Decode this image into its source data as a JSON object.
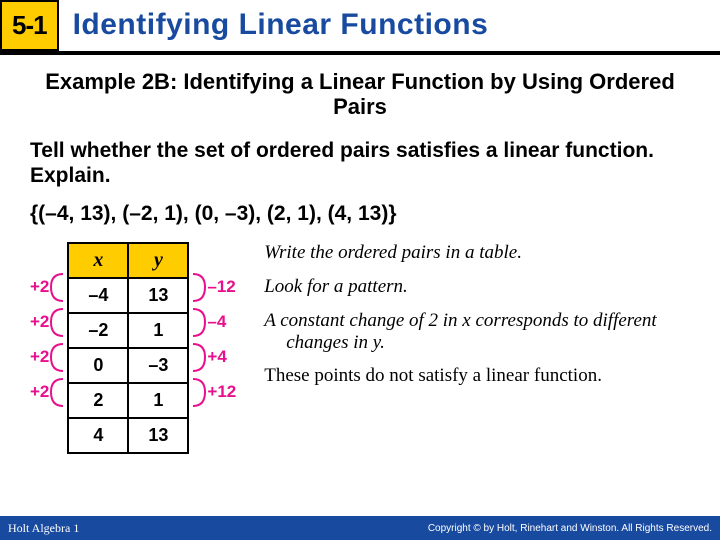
{
  "header": {
    "badge": "5-1",
    "title": "Identifying Linear Functions"
  },
  "example_title": "Example 2B: Identifying a Linear Function by Using Ordered Pairs",
  "instruction": "Tell whether the set of ordered pairs satisfies a linear function. Explain.",
  "ordered_pairs": "{(–4, 13), (–2, 1), (0, –3), (2, 1), (4, 13)}",
  "table": {
    "head_x": "x",
    "head_y": "y",
    "rows": [
      {
        "x": "–4",
        "y": "13"
      },
      {
        "x": "–2",
        "y": "1"
      },
      {
        "x": "0",
        "y": "–3"
      },
      {
        "x": "2",
        "y": "1"
      },
      {
        "x": "4",
        "y": "13"
      }
    ]
  },
  "dx": [
    "+2",
    "+2",
    "+2",
    "+2"
  ],
  "dy": [
    "–12",
    "–4",
    "+4",
    "+12"
  ],
  "text": {
    "p1": "Write the ordered pairs in a table.",
    "p2": "Look for a pattern.",
    "p3": "A constant change of  2 in x corresponds to different changes in y.",
    "p4": "These points do not satisfy a linear function."
  },
  "footer": {
    "book": "Holt Algebra 1",
    "copy": "Copyright © by Holt, Rinehart and Winston. All Rights Reserved."
  }
}
